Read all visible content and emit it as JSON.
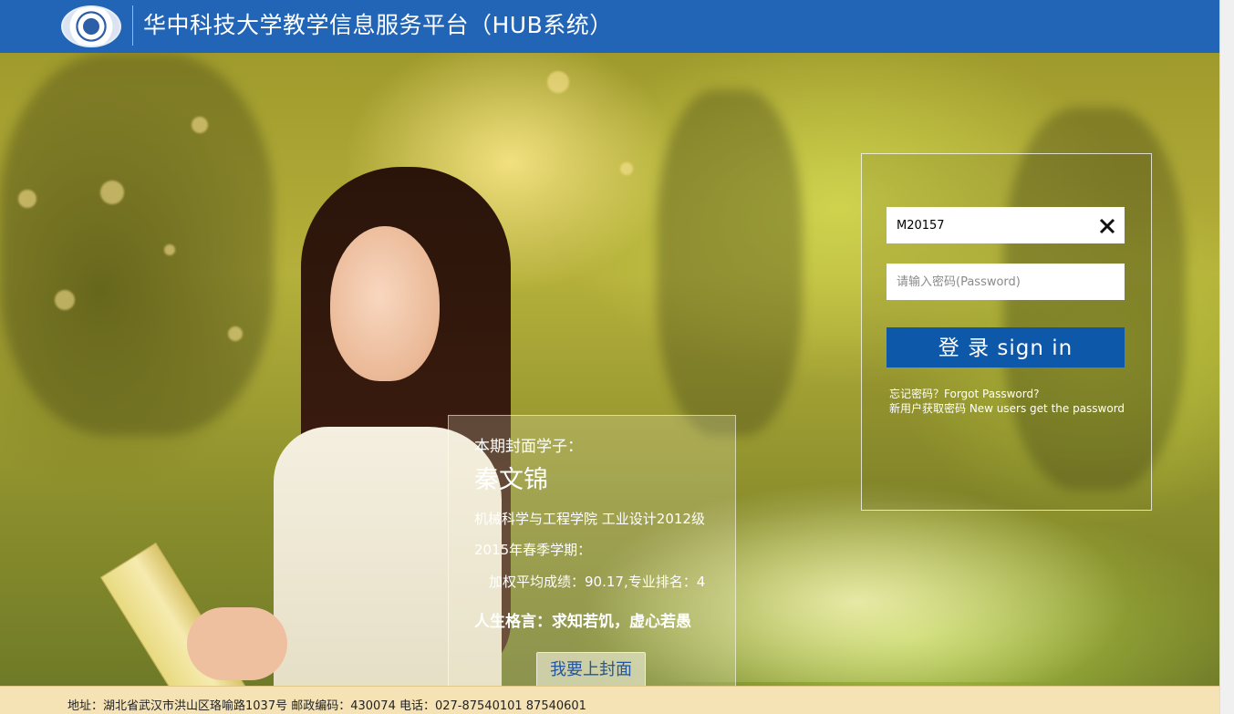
{
  "header": {
    "title": "华中科技大学教学信息服务平台（HUB系统）"
  },
  "feature": {
    "caption": "本期封面学子：",
    "name": "秦文锦",
    "dept": "机械科学与工程学院 工业设计2012级",
    "term": "2015年春季学期：",
    "score": "加权平均成绩：90.17,专业排名：4",
    "motto": "人生格言：求知若饥，虚心若愚",
    "button_label": "我要上封面"
  },
  "login": {
    "username_value": "M20157",
    "password_placeholder": "请输入密码(Password)",
    "button_label": "登 录 sign in",
    "forgot_link": "忘记密码？Forgot Password?",
    "newuser_link": "新用户获取密码 New users get the password",
    "clear_icon": "close-icon"
  },
  "footer": {
    "text": "地址：湖北省武汉市洪山区珞喻路1037号   邮政编码：430074   电话：027-87540101 87540601"
  },
  "colors": {
    "header_bg": "#2264b6",
    "login_button_bg": "#0d58a9",
    "footer_bg": "#f5e3b5",
    "cover_button_text": "#23569d"
  }
}
